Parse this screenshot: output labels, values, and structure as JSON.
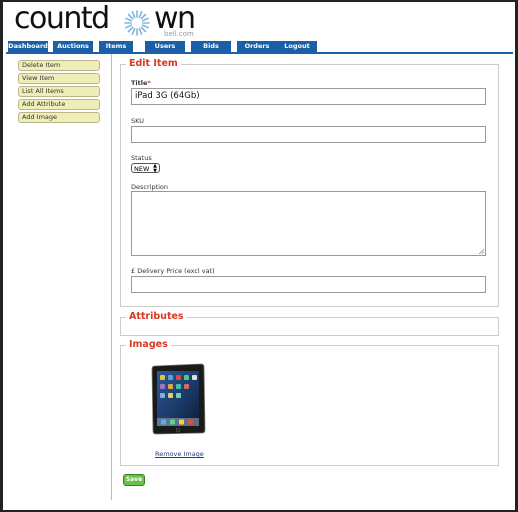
{
  "logo": {
    "part1": "countd",
    "part2": "wn",
    "subtitle": "bell.com"
  },
  "nav": {
    "tabs": [
      "Dashboard",
      "Auctions",
      "Items",
      "Users",
      "Bids",
      "Orders",
      "Logout"
    ]
  },
  "sidebar": {
    "items": [
      "Delete Item",
      "View Item",
      "List All Items",
      "Add Attribute",
      "Add Image"
    ]
  },
  "edit_item": {
    "legend": "Edit Item",
    "title_label": "Title",
    "title_required_mark": "*",
    "title_value": "iPad 3G (64Gb)",
    "sku_label": "SKU",
    "sku_value": "",
    "status_label": "Status",
    "status_value": "NEW",
    "description_label": "Description",
    "description_value": "",
    "delivery_label": "£ Delivery Price (excl vat)",
    "delivery_value": ""
  },
  "attributes": {
    "legend": "Attributes"
  },
  "images": {
    "legend": "Images",
    "remove_label": "Remove Image"
  },
  "actions": {
    "save_label": "Save"
  },
  "colors": {
    "nav": "#1b5fa6",
    "legend": "#d63a21",
    "sidebar_button": "#efeeb8",
    "save_button": "#6bbf4a"
  }
}
